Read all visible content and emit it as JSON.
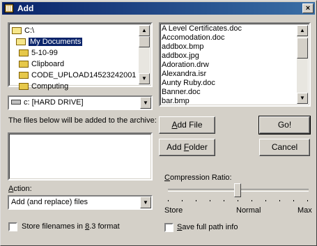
{
  "window": {
    "title": "Add",
    "close_glyph": "×"
  },
  "folders": [
    {
      "label": "C:\\",
      "icon": "open-folder-icon",
      "selected": false
    },
    {
      "label": "My Documents",
      "icon": "open-folder-icon",
      "selected": true
    },
    {
      "label": "5-10-99",
      "icon": "folder-icon",
      "selected": false
    },
    {
      "label": "Clipboard",
      "icon": "folder-icon",
      "selected": false
    },
    {
      "label": "CODE_UPLOAD14523242001",
      "icon": "folder-icon",
      "selected": false
    },
    {
      "label": "Computing",
      "icon": "folder-icon",
      "selected": false
    }
  ],
  "files": [
    "A Level Certificates.doc",
    "Accomodation.doc",
    "addbox.bmp",
    "addbox.jpg",
    "Adoration.drw",
    "Alexandra.isr",
    "Aunty Ruby.doc",
    "Banner.doc",
    "bar.bmp"
  ],
  "drive": {
    "value": "c: [HARD DRIVE]"
  },
  "archive": {
    "label": "The files below will be added to the archive:"
  },
  "action": {
    "label_prefix": "A",
    "label_rest": "ction:",
    "value": "Add (and replace) files"
  },
  "store83": {
    "pre": "Store filenames in ",
    "u": "8",
    "post": ".3 format",
    "checked": false
  },
  "buttons": {
    "add_file_u": "A",
    "add_file_rest": "dd File",
    "add_folder_pre": "Add ",
    "add_folder_u": "F",
    "add_folder_rest": "older",
    "go": "Go!",
    "cancel": "Cancel"
  },
  "compression": {
    "label_pre": "",
    "label_u": "C",
    "label_rest": "ompression Ratio:",
    "min": "Store",
    "mid": "Normal",
    "max": "Max",
    "level": 0.5
  },
  "save_path": {
    "u": "S",
    "rest": "ave full path info",
    "checked": false
  },
  "colors": {
    "selection": "#0a246a",
    "face": "#d4d0c8"
  }
}
